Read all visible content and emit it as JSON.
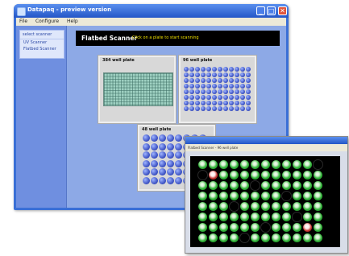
{
  "window": {
    "title": "Datapaq - preview version",
    "controls": {
      "minimize": "_",
      "maximize": "□",
      "close": "✕"
    }
  },
  "menu": [
    "File",
    "Configure",
    "Help"
  ],
  "sidebar": {
    "heading": "select scanner",
    "items": [
      "UV Scanner",
      "Flatbed Scanner"
    ]
  },
  "header": {
    "title": "Flatbed Scanner",
    "hint": "Click on a plate to start scanning"
  },
  "plates": [
    {
      "title": "384 well plate",
      "wells": 384
    },
    {
      "title": "96 well plate",
      "wells": 96
    },
    {
      "title": "48 well plate",
      "wells": 48
    }
  ],
  "scan_window": {
    "toolbar": "Flatbed Scanner - 96 well plate",
    "wells_grid": {
      "columns": 12,
      "rows": 8
    },
    "black_wells": [
      [
        0,
        11
      ],
      [
        1,
        0
      ],
      [
        2,
        5
      ],
      [
        3,
        8
      ],
      [
        4,
        3
      ],
      [
        5,
        9
      ],
      [
        6,
        6
      ],
      [
        7,
        4
      ]
    ],
    "red_wells": [
      [
        1,
        1
      ],
      [
        6,
        10
      ]
    ]
  },
  "colors": {
    "titlebar": "#2356c7",
    "sidebar": "#6f8fe0",
    "header_bar": "#000000",
    "hint": "#f2e400",
    "well_blue": "#4258c8",
    "well_green": "#33b43a",
    "well_red": "#c0302c"
  }
}
